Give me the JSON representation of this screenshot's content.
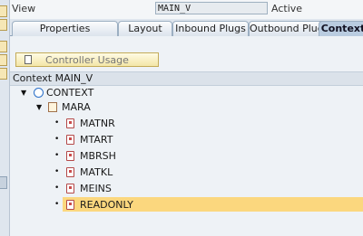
{
  "header": {
    "view_label": "View",
    "view_value": "MAIN_V",
    "status": "Active"
  },
  "tabs": [
    {
      "label": "Properties"
    },
    {
      "label": "Layout"
    },
    {
      "label": "Inbound Plugs"
    },
    {
      "label": "Outbound Plugs"
    },
    {
      "label": "Context"
    }
  ],
  "controller_usage_button": "Controller Usage",
  "context_panel": {
    "title": "Context MAIN_V",
    "root": {
      "label": "CONTEXT",
      "icon": "context-circle-icon"
    },
    "node": {
      "label": "MARA",
      "icon": "node-icon"
    },
    "attributes": [
      "MATNR",
      "MTART",
      "MBRSH",
      "MATKL",
      "MEINS",
      "READONLY"
    ],
    "selected_attribute": "READONLY"
  },
  "colors": {
    "selection": "#fbd77e",
    "active_tab": "#b9cce0",
    "button_fill": "#f3e6a7"
  }
}
